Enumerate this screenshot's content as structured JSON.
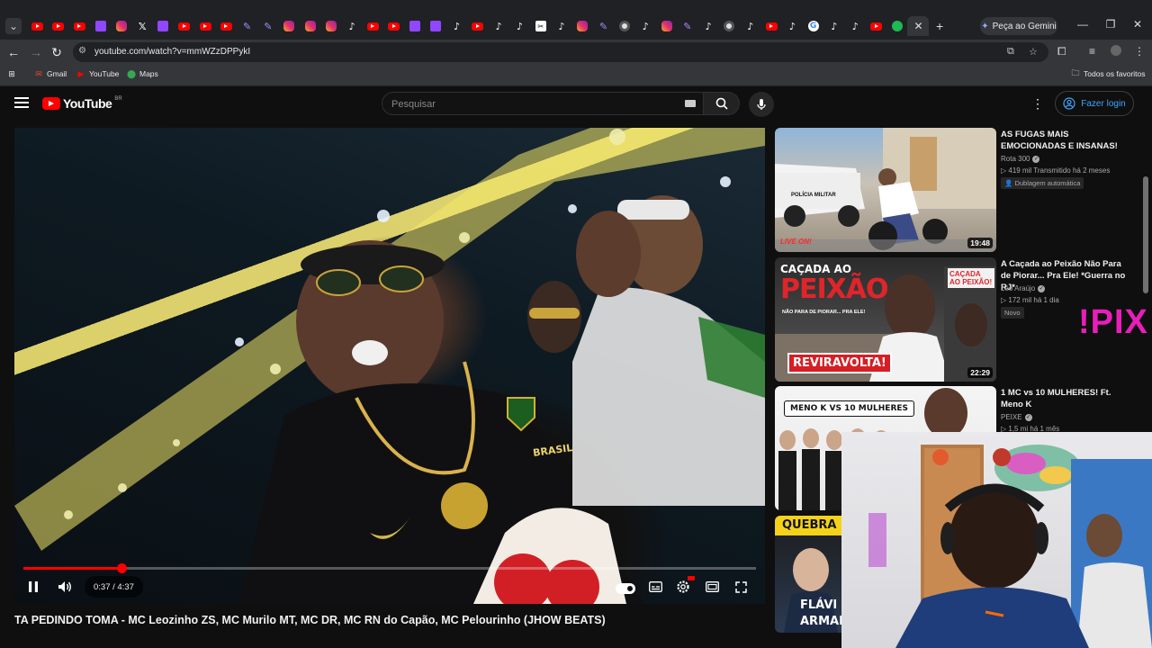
{
  "browser": {
    "tab_favicons": [
      "youtube",
      "youtube",
      "youtube",
      "twitch",
      "instagram",
      "x",
      "twitch",
      "youtube",
      "youtube",
      "youtube",
      "feather",
      "feather",
      "instagram",
      "instagram",
      "instagram",
      "tiktok",
      "youtube",
      "youtube",
      "twitch",
      "twitch",
      "tiktok",
      "youtube",
      "tiktok",
      "tiktok",
      "capcut",
      "tiktok",
      "instagram",
      "feather",
      "chrome",
      "tiktok",
      "instagram",
      "feather",
      "tiktok",
      "chrome",
      "tiktok",
      "youtube",
      "tiktok",
      "google",
      "tiktok",
      "tiktok",
      "youtube",
      "spotify"
    ],
    "gemini_label": "Peça ao Gemini",
    "url": "youtube.com/watch?v=mmWZzDPPykI",
    "bookmarks": [
      {
        "label": "Gmail",
        "icon": "gmail-icon"
      },
      {
        "label": "YouTube",
        "icon": "youtube-icon"
      },
      {
        "label": "Maps",
        "icon": "maps-icon"
      }
    ],
    "all_bookmarks_label": "Todos os favoritos"
  },
  "youtube": {
    "logo_text": "YouTube",
    "country_code": "BR",
    "search_placeholder": "Pesquisar",
    "login_label": "Fazer login"
  },
  "player": {
    "current_time": "0:37",
    "duration": "4:37",
    "time_display": "0:37 / 4:37",
    "progress_fraction": 0.134,
    "jersey_text": "BRASIL"
  },
  "video_title": "TA PEDINDO TOMA - MC Leozinho ZS, MC Murilo MT, MC DR, MC RN do Capão, MC Pelourinho (JHOW BEATS)",
  "recommendations": [
    {
      "title": "AS FUGAS MAIS EMOCIONADAS E INSANAS!",
      "channel": "Rota 300",
      "meta": "▷ 419 mil  Transmitido há 2 meses",
      "badge": "Dublagem automática",
      "duration": "19:48",
      "thumb_text": "POLÍCIA MILITAR",
      "thumb_tag": "LIVE ON!"
    },
    {
      "title": "A Caçada ao Peixão Não Para de Piorar... Pra Ele! *Guerra no RJ*",
      "channel": "Léo Araújo",
      "meta": "▷ 172 mil  há 1 dia",
      "badge": "Novo",
      "duration": "22:29",
      "thumb_line1": "CAÇADA AO",
      "thumb_line2": "PEIXÃO",
      "thumb_line3": "NÃO PARA DE PIORAR... PRA ELE!",
      "thumb_banner": "REVIRAVOLTA!",
      "thumb_side": "CAÇADA AO PEIXÃO!"
    },
    {
      "title": "1 MC vs 10 MULHERES! Ft. Meno K",
      "channel": "PEIXE",
      "meta": "▷ 1,5 mi  há 1 mês",
      "thumb_text": "MENO K VS 10 MULHERES"
    },
    {
      "thumb_text": "QUEBRA I",
      "thumb_name": "FLÁVI",
      "thumb_name2": "ARMAD"
    }
  ],
  "overlay_text": "!PIX"
}
